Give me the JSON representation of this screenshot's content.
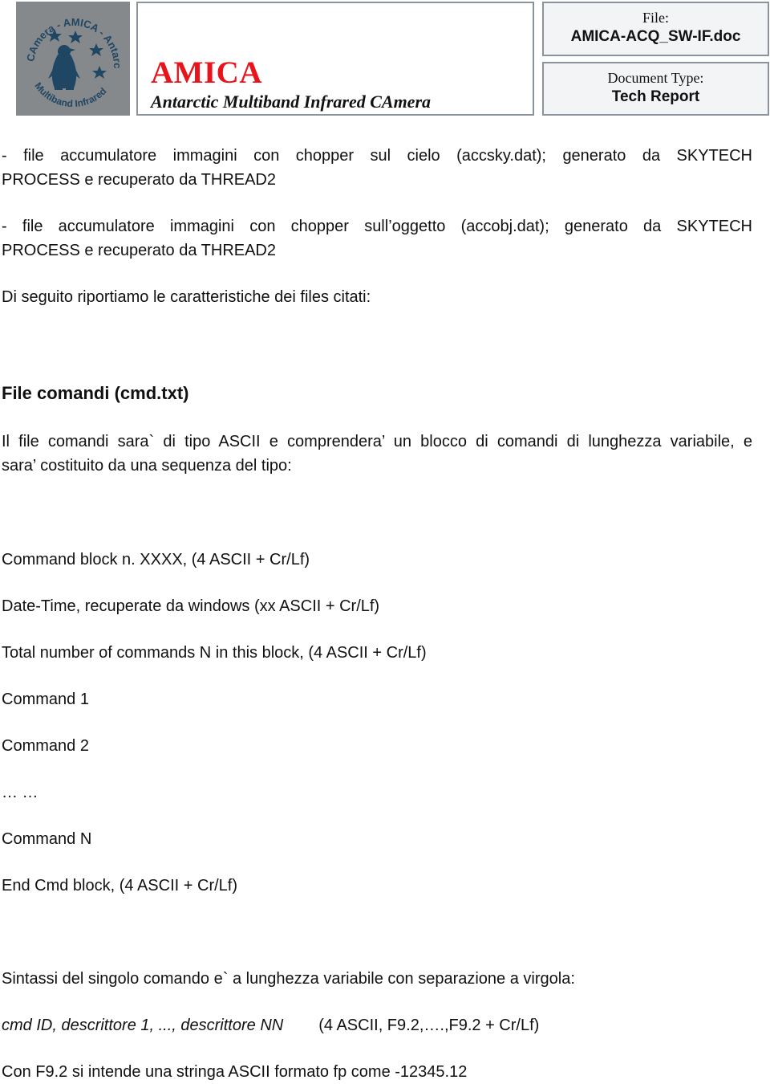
{
  "header": {
    "logo": {
      "icon": "amica-penguin-logo",
      "ring_text_top": "AMICA",
      "ring_text_right": "Antarctic",
      "ring_text_bottom": "Multiband Infrared",
      "ring_text_left": "CAmera",
      "background_color": "#86898b",
      "emblem_color": "#1f4663"
    },
    "title": "AMICA",
    "title_color": "#e8141b",
    "subtitle": "Antarctic Multiband Infrared CAmera",
    "file_label": "File:",
    "file_value": "AMICA-ACQ_SW-IF.doc",
    "doc_type_label": "Document Type:",
    "doc_type_value": "Tech Report"
  },
  "body": {
    "bullet_1_line_1": "- file accumulatore immagini con chopper sul cielo (accsky.dat); generato da SKYTECH",
    "bullet_1_line_2": "PROCESS e recuperato da THREAD2",
    "bullet_2_line_1": "- file accumulatore immagini con chopper sull’oggetto (accobj.dat); generato da SKYTECH",
    "bullet_2_line_2": "PROCESS e recuperato da THREAD2",
    "intro": "Di seguito riportiamo le caratteristiche dei files citati:",
    "section_heading": "File comandi (cmd.txt)",
    "section_para_line_1": "Il file comandi sara` di tipo ASCII e comprendera’ un blocco di comandi di lunghezza variabile, e",
    "section_para_line_2": "sara’ costituito da una sequenza del tipo:",
    "sequence": [
      "Command block n. XXXX,  (4 ASCII + Cr/Lf)",
      "Date-Time, recuperate da windows (xx ASCII + Cr/Lf)",
      "Total number of commands N in this block, (4 ASCII + Cr/Lf)",
      "Command 1",
      "Command 2",
      "… …",
      "Command N",
      "End Cmd block, (4 ASCII + Cr/Lf)"
    ],
    "syntax_intro": "Sintassi del singolo comando e` a lunghezza variabile con separazione a virgola:",
    "syntax_format": "cmd ID, descrittore 1, ..., descrittore NN",
    "syntax_types": "(4 ASCII, F9.2,….,F9.2 + Cr/Lf)",
    "f92_note": "Con F9.2 si intende una stringa ASCII formato fp come -12345.12"
  }
}
